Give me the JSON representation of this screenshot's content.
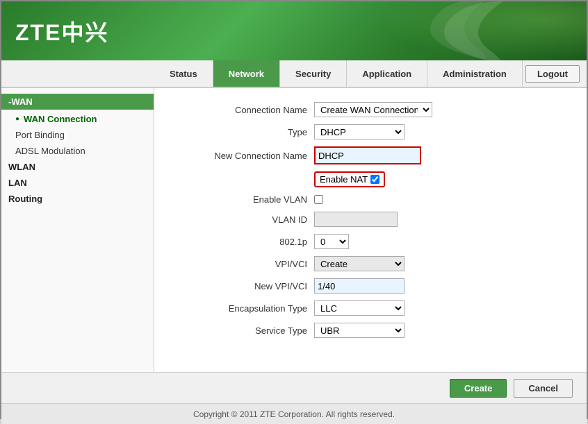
{
  "header": {
    "logo": "ZTE中兴"
  },
  "navbar": {
    "items": [
      {
        "label": "Status",
        "active": false
      },
      {
        "label": "Network",
        "active": true
      },
      {
        "label": "Security",
        "active": false
      },
      {
        "label": "Application",
        "active": false
      },
      {
        "label": "Administration",
        "active": false
      }
    ],
    "logout_label": "Logout"
  },
  "sidebar": {
    "wan_section": "-WAN",
    "wan_items": [
      {
        "label": "WAN Connection",
        "active": true
      },
      {
        "label": "Port Binding",
        "active": false
      },
      {
        "label": "ADSL Modulation",
        "active": false
      }
    ],
    "wlan_section": "WLAN",
    "lan_section": "LAN",
    "routing_section": "Routing"
  },
  "form": {
    "connection_name_label": "Connection Name",
    "connection_name_value": "Create WAN Connection",
    "type_label": "Type",
    "type_value": "DHCP",
    "new_connection_name_label": "New Connection Name",
    "new_connection_name_value": "DHCP",
    "enable_nat_label": "Enable NAT",
    "enable_nat_checked": true,
    "enable_vlan_label": "Enable VLAN",
    "enable_vlan_checked": false,
    "vlan_id_label": "VLAN ID",
    "vlan_id_value": "",
    "dot1p_label": "802.1p",
    "dot1p_value": "0",
    "vpivci_label": "VPI/VCI",
    "vpivci_value": "Create",
    "new_vpivci_label": "New VPI/VCI",
    "new_vpivci_value": "1/40",
    "encapsulation_label": "Encapsulation Type",
    "encapsulation_value": "LLC",
    "service_type_label": "Service Type",
    "service_type_value": "UBR"
  },
  "actions": {
    "create_label": "Create",
    "cancel_label": "Cancel"
  },
  "footer": {
    "copyright": "Copyright © 2011 ZTE Corporation. All rights reserved."
  }
}
